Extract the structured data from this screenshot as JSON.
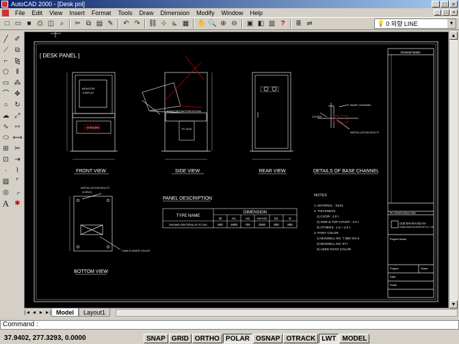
{
  "window": {
    "title": "AutoCAD 2000 - [Desk pnl]",
    "min": "_",
    "max": "□",
    "close": "×"
  },
  "menu": [
    "File",
    "Edit",
    "View",
    "Insert",
    "Format",
    "Tools",
    "Draw",
    "Dimension",
    "Modify",
    "Window",
    "Help"
  ],
  "layer": {
    "value": "0 외향 LINE"
  },
  "drawing": {
    "title": "[ DESK PANEL ]",
    "views": [
      "FRONT VIEW",
      "SIDE VIEW",
      "REAR VIEW",
      "DETAILS OF BASE CHANNEL",
      "BOTTOM VIEW"
    ],
    "front_labels": [
      "MONITOR",
      "DISPLAY",
      "KEYBOARD"
    ],
    "side_labels": [
      "MONITOR/FUNCTION KEYPAD",
      "PC BOX"
    ],
    "channel_labels": [
      "BASE CHANNEL",
      "INSTALLATION BOLTS",
      "COVER"
    ],
    "bottom_labels": [
      "INSTALLATION BOLTS",
      "(4-M12)",
      "CABLE INNER HOLES"
    ],
    "panel_description": {
      "title": "PANEL DESCRIPTION",
      "type_header": "TYPE NAME",
      "dimension_header": "DIMENSION",
      "columns": [
        "W",
        "H1",
        "H2",
        "H1+H2",
        "D1",
        "D"
      ],
      "row": {
        "type": "SHOWR-DSKTEEN-1P-ST-001",
        "values": [
          "800",
          "1600",
          "700",
          "2500",
          "800",
          "850"
        ]
      }
    },
    "notes": {
      "title": "NOTES",
      "lines": [
        "1. MATERIAL : SS41",
        "2. THICKNESS",
        "  1) COOR : 2.0 t",
        "  2) SIDE & TOP COVER : 2.0 t",
        "  3) OTHERS : 1.6 ~ 2.0 t",
        "3. PAINT COLOR",
        "  1) MUNSELL NO. 7.5BG 6/1.5",
        "  2) MUNSELL NO. 5Y7",
        "  3) USER PAINT COLOR"
      ]
    },
    "title_block": {
      "general_notes": "General Notes",
      "rev_header": "No.  Revision/Issue  Date",
      "company_line1": "(주)한 한국서비스산업 E&C",
      "company_line2": "KOREA SERVICE INDUSTRY CO., LTD.",
      "project_name": "Project Name",
      "project": "Project",
      "sheet": "Sheet",
      "date": "Date",
      "scale": "Scale"
    }
  },
  "tabs": {
    "nav": [
      "|◄",
      "◄",
      "►",
      "►|"
    ],
    "model": "Model",
    "layout1": "Layout1"
  },
  "command": {
    "prompt": "Command :"
  },
  "status": {
    "coords": "37.9402, 277.3293, 0.0000",
    "buttons": [
      {
        "label": "SNAP",
        "on": false
      },
      {
        "label": "GRID",
        "on": false
      },
      {
        "label": "ORTHO",
        "on": false
      },
      {
        "label": "POLAR",
        "on": true
      },
      {
        "label": "OSNAP",
        "on": false
      },
      {
        "label": "OTRACK",
        "on": false
      },
      {
        "label": "LWT",
        "on": true
      },
      {
        "label": "MODEL",
        "on": false
      }
    ]
  }
}
